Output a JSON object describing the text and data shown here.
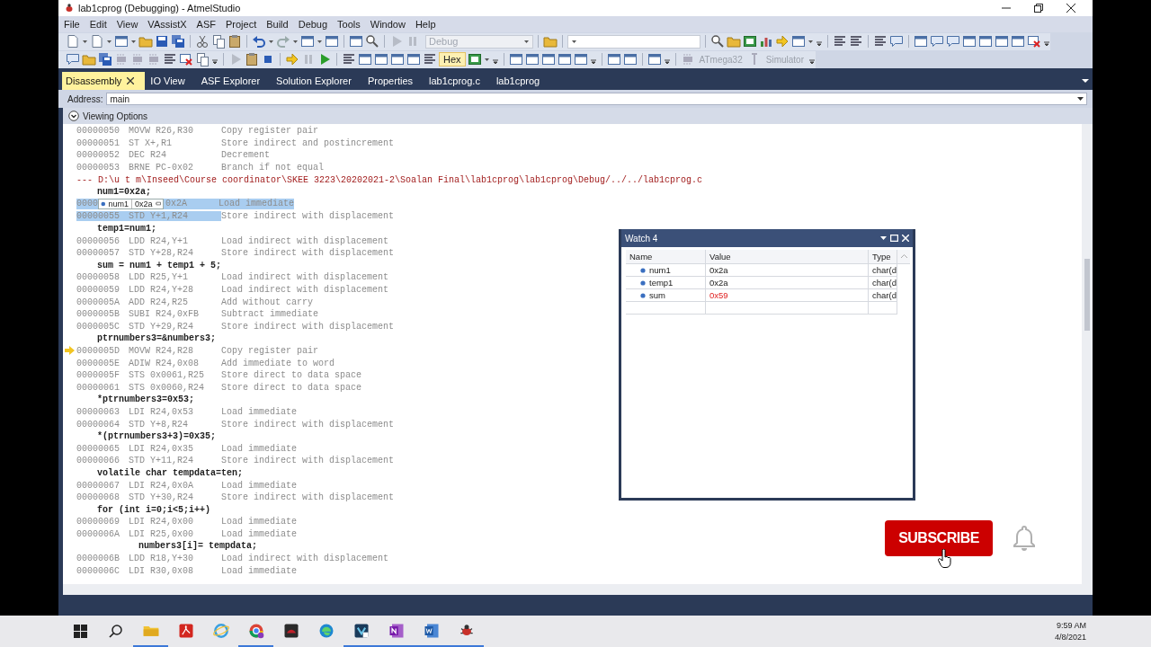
{
  "window": {
    "title": "lab1cprog (Debugging) - AtmelStudio"
  },
  "menu": [
    "File",
    "Edit",
    "View",
    "VAssistX",
    "ASF",
    "Project",
    "Build",
    "Debug",
    "Tools",
    "Window",
    "Help"
  ],
  "toolbar": {
    "configuration": "Debug",
    "hex": {
      "label": "Hex",
      "selected": true
    },
    "device": "ATmega32",
    "tool": "Simulator"
  },
  "tabs": [
    {
      "label": "Disassembly",
      "selected": true
    },
    {
      "label": "IO View",
      "selected": false
    },
    {
      "label": "ASF Explorer",
      "selected": false
    },
    {
      "label": "Solution Explorer",
      "selected": false
    },
    {
      "label": "Properties",
      "selected": false
    },
    {
      "label": "lab1cprog.c",
      "selected": false
    },
    {
      "label": "lab1cprog",
      "selected": false
    }
  ],
  "address_bar": {
    "label": "Address:",
    "value": "main"
  },
  "viewing_options": {
    "label": "Viewing Options"
  },
  "code_lines": [
    {
      "kind": "asm",
      "address": "00000050",
      "instruction": "MOVW R26,R30",
      "comment": "Copy register pair",
      "selected": false,
      "current": false
    },
    {
      "kind": "asm",
      "address": "00000051",
      "instruction": "ST X+,R1",
      "comment": "Store indirect and postincrement",
      "selected": false,
      "current": false
    },
    {
      "kind": "asm",
      "address": "00000052",
      "instruction": "DEC R24",
      "comment": "Decrement",
      "selected": false,
      "current": false
    },
    {
      "kind": "asm",
      "address": "00000053",
      "instruction": "BRNE PC-0x02",
      "comment": "Branch if not equal",
      "selected": false,
      "current": false
    },
    {
      "kind": "path",
      "text": "--- D:\\u t m\\Inseed\\Course coordinator\\SKEE 3223\\20202021-2\\Soalan Final\\lab1cprog\\lab1cprog\\Debug/../../lab1cprog.c"
    },
    {
      "kind": "source",
      "text": "num1=0x2a;"
    },
    {
      "kind": "tip",
      "address": "0000",
      "tip_name": "num1",
      "tip_value": "0x2a",
      "instruction": "0x2A",
      "comment": "Load immediate",
      "selected": true,
      "current": false
    },
    {
      "kind": "asm",
      "address": "00000055",
      "instruction": "STD Y+1,R24",
      "comment": "Store indirect with displacement",
      "selected": true,
      "current": false
    },
    {
      "kind": "source",
      "text": "temp1=num1;"
    },
    {
      "kind": "asm",
      "address": "00000056",
      "instruction": "LDD R24,Y+1",
      "comment": "Load indirect with displacement",
      "selected": false,
      "current": false
    },
    {
      "kind": "asm",
      "address": "00000057",
      "instruction": "STD Y+28,R24",
      "comment": "Store indirect with displacement",
      "selected": false,
      "current": false
    },
    {
      "kind": "source",
      "text": "sum = num1 + temp1 + 5;"
    },
    {
      "kind": "asm",
      "address": "00000058",
      "instruction": "LDD R25,Y+1",
      "comment": "Load indirect with displacement",
      "selected": false,
      "current": false
    },
    {
      "kind": "asm",
      "address": "00000059",
      "instruction": "LDD R24,Y+28",
      "comment": "Load indirect with displacement",
      "selected": false,
      "current": false
    },
    {
      "kind": "asm",
      "address": "0000005A",
      "instruction": "ADD R24,R25",
      "comment": "Add without carry",
      "selected": false,
      "current": false
    },
    {
      "kind": "asm",
      "address": "0000005B",
      "instruction": "SUBI R24,0xFB",
      "comment": "Subtract immediate",
      "selected": false,
      "current": false
    },
    {
      "kind": "asm",
      "address": "0000005C",
      "instruction": "STD Y+29,R24",
      "comment": "Store indirect with displacement",
      "selected": false,
      "current": false
    },
    {
      "kind": "source",
      "text": "ptrnumbers3=&numbers3;"
    },
    {
      "kind": "asm",
      "address": "0000005D",
      "instruction": "MOVW R24,R28",
      "comment": "Copy register pair",
      "selected": false,
      "current": true
    },
    {
      "kind": "asm",
      "address": "0000005E",
      "instruction": "ADIW R24,0x08",
      "comment": "Add immediate to word",
      "selected": false,
      "current": false
    },
    {
      "kind": "asm",
      "address": "0000005F",
      "instruction": "STS 0x0061,R25",
      "comment": "Store direct to data space",
      "selected": false,
      "current": false
    },
    {
      "kind": "asm",
      "address": "00000061",
      "instruction": "STS 0x0060,R24",
      "comment": "Store direct to data space",
      "selected": false,
      "current": false
    },
    {
      "kind": "source",
      "text": "*ptrnumbers3=0x53;"
    },
    {
      "kind": "asm",
      "address": "00000063",
      "instruction": "LDI R24,0x53",
      "comment": "Load immediate",
      "selected": false,
      "current": false
    },
    {
      "kind": "asm",
      "address": "00000064",
      "instruction": "STD Y+8,R24",
      "comment": "Store indirect with displacement",
      "selected": false,
      "current": false
    },
    {
      "kind": "source",
      "text": "*(ptrnumbers3+3)=0x35;"
    },
    {
      "kind": "asm",
      "address": "00000065",
      "instruction": "LDI R24,0x35",
      "comment": "Load immediate",
      "selected": false,
      "current": false
    },
    {
      "kind": "asm",
      "address": "00000066",
      "instruction": "STD Y+11,R24",
      "comment": "Store indirect with displacement",
      "selected": false,
      "current": false
    },
    {
      "kind": "source",
      "text": "volatile char tempdata=ten;"
    },
    {
      "kind": "asm",
      "address": "00000067",
      "instruction": "LDI R24,0x0A",
      "comment": "Load immediate",
      "selected": false,
      "current": false
    },
    {
      "kind": "asm",
      "address": "00000068",
      "instruction": "STD Y+30,R24",
      "comment": "Store indirect with displacement",
      "selected": false,
      "current": false
    },
    {
      "kind": "source",
      "text": "for (int i=0;i<5;i++)"
    },
    {
      "kind": "asm",
      "address": "00000069",
      "instruction": "LDI R24,0x00",
      "comment": "Load immediate",
      "selected": false,
      "current": false
    },
    {
      "kind": "asm",
      "address": "0000006A",
      "instruction": "LDI R25,0x00",
      "comment": "Load immediate",
      "selected": false,
      "current": false
    },
    {
      "kind": "source_inner",
      "text": "numbers3[i]= tempdata;"
    },
    {
      "kind": "asm",
      "address": "0000006B",
      "instruction": "LDD R18,Y+30",
      "comment": "Load indirect with displacement",
      "selected": false,
      "current": false
    },
    {
      "kind": "asm",
      "address": "0000006C",
      "instruction": "LDI R30,0x08",
      "comment": "Load immediate",
      "selected": false,
      "current": false
    }
  ],
  "watch": {
    "title": "Watch 4",
    "columns": [
      "Name",
      "Value",
      "Type"
    ],
    "rows": [
      {
        "name": "num1",
        "value": "0x2a",
        "type": "char(d",
        "changed": false
      },
      {
        "name": "temp1",
        "value": "0x2a",
        "type": "char(d",
        "changed": false
      },
      {
        "name": "sum",
        "value": "0x59",
        "type": "char(d",
        "changed": true
      }
    ]
  },
  "overlay": {
    "subscribe": "SUBSCRIBE"
  },
  "taskbar": {
    "apps": [
      {
        "kind": "explorer",
        "running": true
      },
      {
        "kind": "pdf",
        "running": false
      },
      {
        "kind": "ie",
        "running": false
      },
      {
        "kind": "chrome",
        "running": true
      },
      {
        "kind": "dark",
        "running": false
      },
      {
        "kind": "edge",
        "running": false
      },
      {
        "kind": "studio",
        "running": true
      },
      {
        "kind": "onenote",
        "running": true
      },
      {
        "kind": "word",
        "running": true
      },
      {
        "kind": "atmel",
        "running": true
      }
    ],
    "time": "9:59 AM",
    "date": "4/8/2021"
  }
}
